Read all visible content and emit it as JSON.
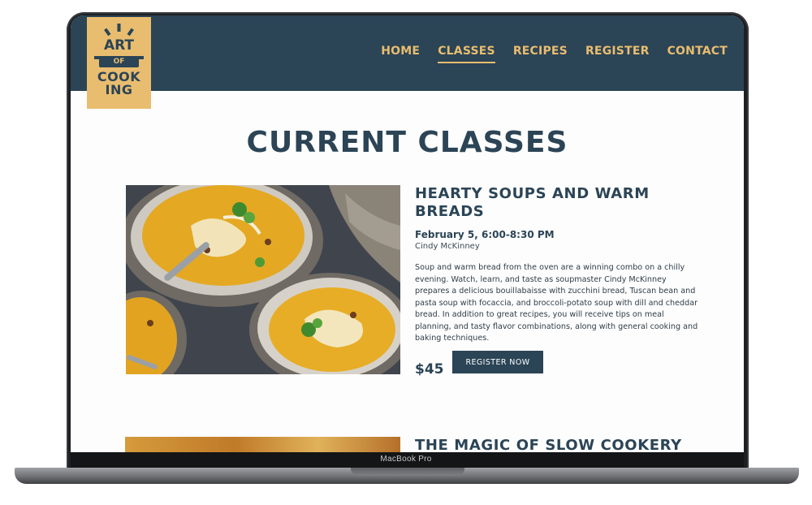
{
  "device": {
    "model_label": "MacBook Pro"
  },
  "logo": {
    "line1": "ART",
    "line2": "OF",
    "line3": "COOK",
    "line4": "ING"
  },
  "nav": {
    "items": [
      {
        "label": "HOME"
      },
      {
        "label": "CLASSES",
        "active": true
      },
      {
        "label": "RECIPES"
      },
      {
        "label": "REGISTER"
      },
      {
        "label": "CONTACT"
      }
    ]
  },
  "page": {
    "title": "CURRENT CLASSES"
  },
  "classes": [
    {
      "title": "HEARTY SOUPS AND WARM BREADS",
      "date": "February 5, 6:00-8:30 PM",
      "instructor": "Cindy McKinney",
      "description": "Soup and warm bread from the oven are a winning combo on a chilly evening. Watch, learn, and taste as soupmaster Cindy McKinney prepares a delicious bouillabaisse with zucchini bread, Tuscan bean and pasta soup with focaccia, and broccoli-potato soup with dill and cheddar bread. In addition to great recipes, you will receive tips on meal planning, and tasty flavor combinations, along with general cooking and baking techniques.",
      "price": "$45",
      "button_label": "REGISTER NOW"
    },
    {
      "title": "THE MAGIC OF SLOW COOKERY"
    }
  ],
  "colors": {
    "navy": "#2b4456",
    "gold": "#e9bd6f"
  }
}
